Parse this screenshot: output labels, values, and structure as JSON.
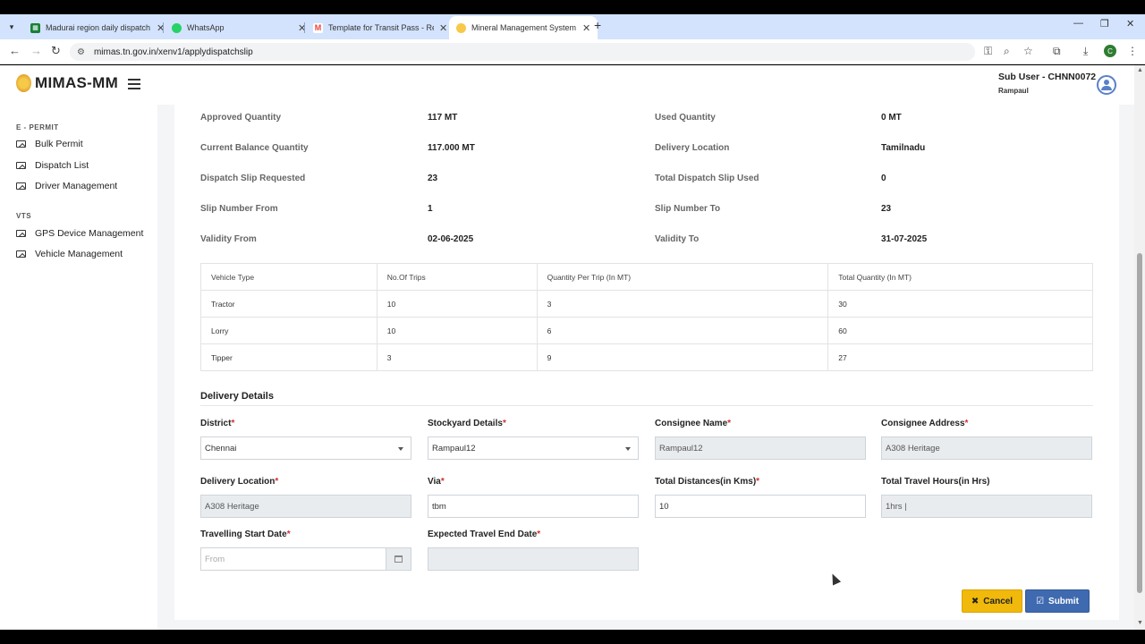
{
  "browser": {
    "tabs": [
      {
        "title": "Madurai region daily dispatch",
        "favicon_color": "#188038"
      },
      {
        "title": "WhatsApp",
        "favicon_color": "#25d366"
      },
      {
        "title": "Template for Transit Pass - Reg",
        "favicon_color": "#ea4335"
      },
      {
        "title": "Mineral Management System",
        "favicon_color": "#c9831a"
      }
    ],
    "url": "mimas.tn.gov.in/xenv1/applydispatchslip",
    "profile_initial": "C"
  },
  "header": {
    "logo_text": "MIMAS-MM",
    "user_name": "Sub User - CHNN0072",
    "user_sub": "Rampaul"
  },
  "sidebar": {
    "sections": [
      {
        "title": "E - PERMIT",
        "items": [
          "Bulk Permit",
          "Dispatch List",
          "Driver Management"
        ]
      },
      {
        "title": "VTS",
        "items": [
          "GPS Device Management",
          "Vehicle Management"
        ]
      }
    ]
  },
  "summary": {
    "approved_quantity": {
      "label": "Approved Quantity",
      "value": "117 MT"
    },
    "used_quantity": {
      "label": "Used Quantity",
      "value": "0 MT"
    },
    "current_balance": {
      "label": "Current Balance Quantity",
      "value": "117.000 MT"
    },
    "delivery_location": {
      "label": "Delivery Location",
      "value": "Tamilnadu"
    },
    "slip_requested": {
      "label": "Dispatch Slip Requested",
      "value": "23"
    },
    "slip_used": {
      "label": "Total Dispatch Slip Used",
      "value": "0"
    },
    "slip_from": {
      "label": "Slip Number From",
      "value": "1"
    },
    "slip_to": {
      "label": "Slip Number To",
      "value": "23"
    },
    "validity_from": {
      "label": "Validity From",
      "value": "02-06-2025"
    },
    "validity_to": {
      "label": "Validity To",
      "value": "31-07-2025"
    }
  },
  "vehicle_table": {
    "headers": [
      "Vehicle Type",
      "No.Of Trips",
      "Quantity Per Trip (In MT)",
      "Total Quantity (In MT)"
    ],
    "rows": [
      [
        "Tractor",
        "10",
        "3",
        "30"
      ],
      [
        "Lorry",
        "10",
        "6",
        "60"
      ],
      [
        "Tipper",
        "3",
        "9",
        "27"
      ]
    ]
  },
  "delivery": {
    "title": "Delivery Details",
    "district": {
      "label": "District",
      "value": "Chennai"
    },
    "stockyard": {
      "label": "Stockyard Details",
      "value": "Rampaul12"
    },
    "consignee_name": {
      "label": "Consignee Name",
      "value": "Rampaul12"
    },
    "consignee_address": {
      "label": "Consignee Address",
      "value": "A308 Heritage"
    },
    "delivery_location": {
      "label": "Delivery Location",
      "value": "A308 Heritage"
    },
    "via": {
      "label": "Via",
      "value": "tbm"
    },
    "total_distance": {
      "label": "Total Distances(in Kms)",
      "value": "10"
    },
    "total_hours": {
      "label": "Total Travel Hours(in Hrs)",
      "value": "1hrs |"
    },
    "start_date": {
      "label": "Travelling Start Date",
      "placeholder": "From"
    },
    "end_date": {
      "label": "Expected Travel End Date",
      "value": ""
    }
  },
  "buttons": {
    "cancel": "Cancel",
    "submit": "Submit"
  }
}
